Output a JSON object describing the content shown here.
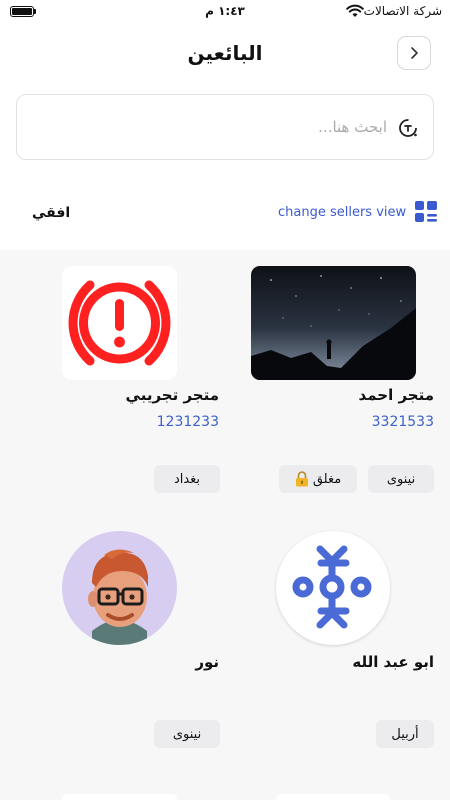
{
  "status_bar": {
    "carrier": "شركة الاتصالات",
    "time": "١:٤٣ م"
  },
  "header": {
    "title": "البائعين",
    "back_icon": "chevron-right-icon"
  },
  "search": {
    "placeholder": "ابحث هنا...",
    "value": "",
    "icon": "search-icon"
  },
  "view_bar": {
    "current_view": "افقي",
    "change_view_label": "change sellers view",
    "icon": "grid-list-icon"
  },
  "colors": {
    "accent": "#3a5ad1",
    "phone": "#3b62c9",
    "chip_bg": "#ececee"
  },
  "sellers": [
    {
      "name": "متجر احمد",
      "phone": "3321533",
      "image": "night-sky-silhouette",
      "tags": [
        "نينوى",
        "مغلق"
      ],
      "closed_icon": "lock-icon"
    },
    {
      "name": "متجر تجريبي",
      "phone": "1231233",
      "image": "warning-icon",
      "tags": [
        "بغداد"
      ]
    },
    {
      "name": "ابو عبد الله",
      "phone": "",
      "image": "nextcloud-talk-logo",
      "tags": [
        "أربيل"
      ]
    },
    {
      "name": "نور",
      "phone": "",
      "image": "memoji-avatar",
      "tags": [
        "نينوى"
      ]
    }
  ]
}
